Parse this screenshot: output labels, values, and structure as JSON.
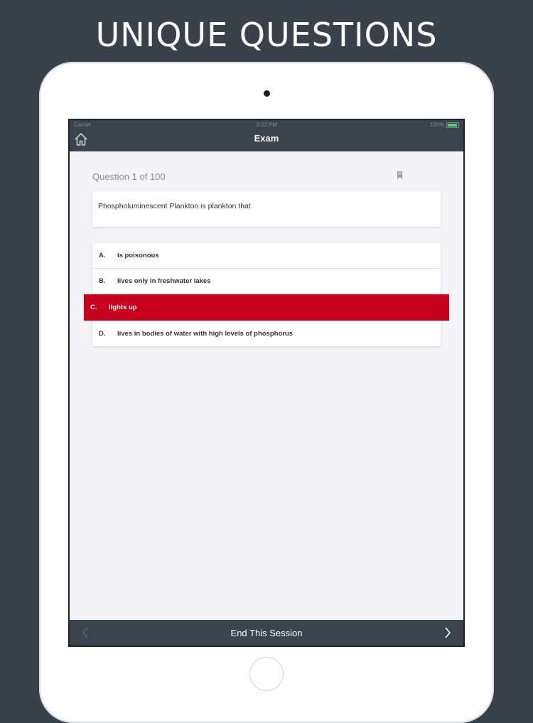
{
  "promo": {
    "title": "UNIQUE QUESTIONS"
  },
  "status_bar": {
    "carrier": "Carrier",
    "time": "3:33 PM",
    "battery": "100%"
  },
  "nav": {
    "title": "Exam",
    "home_icon": "home-icon"
  },
  "question": {
    "counter": "Question 1 of 100",
    "text": "Phospholuminescent Plankton is plankton that",
    "bookmark_icon": "bookmark-icon"
  },
  "answers": [
    {
      "letter": "A.",
      "text": "is poisonous",
      "selected": false
    },
    {
      "letter": "B.",
      "text": "lives only in freshwater lakes",
      "selected": false
    },
    {
      "letter": "C.",
      "text": "lights up",
      "selected": true
    },
    {
      "letter": "D.",
      "text": "lives in bodies of water with high levels of phosphorus",
      "selected": false
    }
  ],
  "bottom_bar": {
    "end_label": "End This Session",
    "prev_icon": "chevron-left-icon",
    "next_icon": "chevron-right-icon"
  },
  "colors": {
    "background": "#39414a",
    "bar": "#3b434c",
    "selected_answer": "#c8001e",
    "battery": "#4cd964"
  }
}
